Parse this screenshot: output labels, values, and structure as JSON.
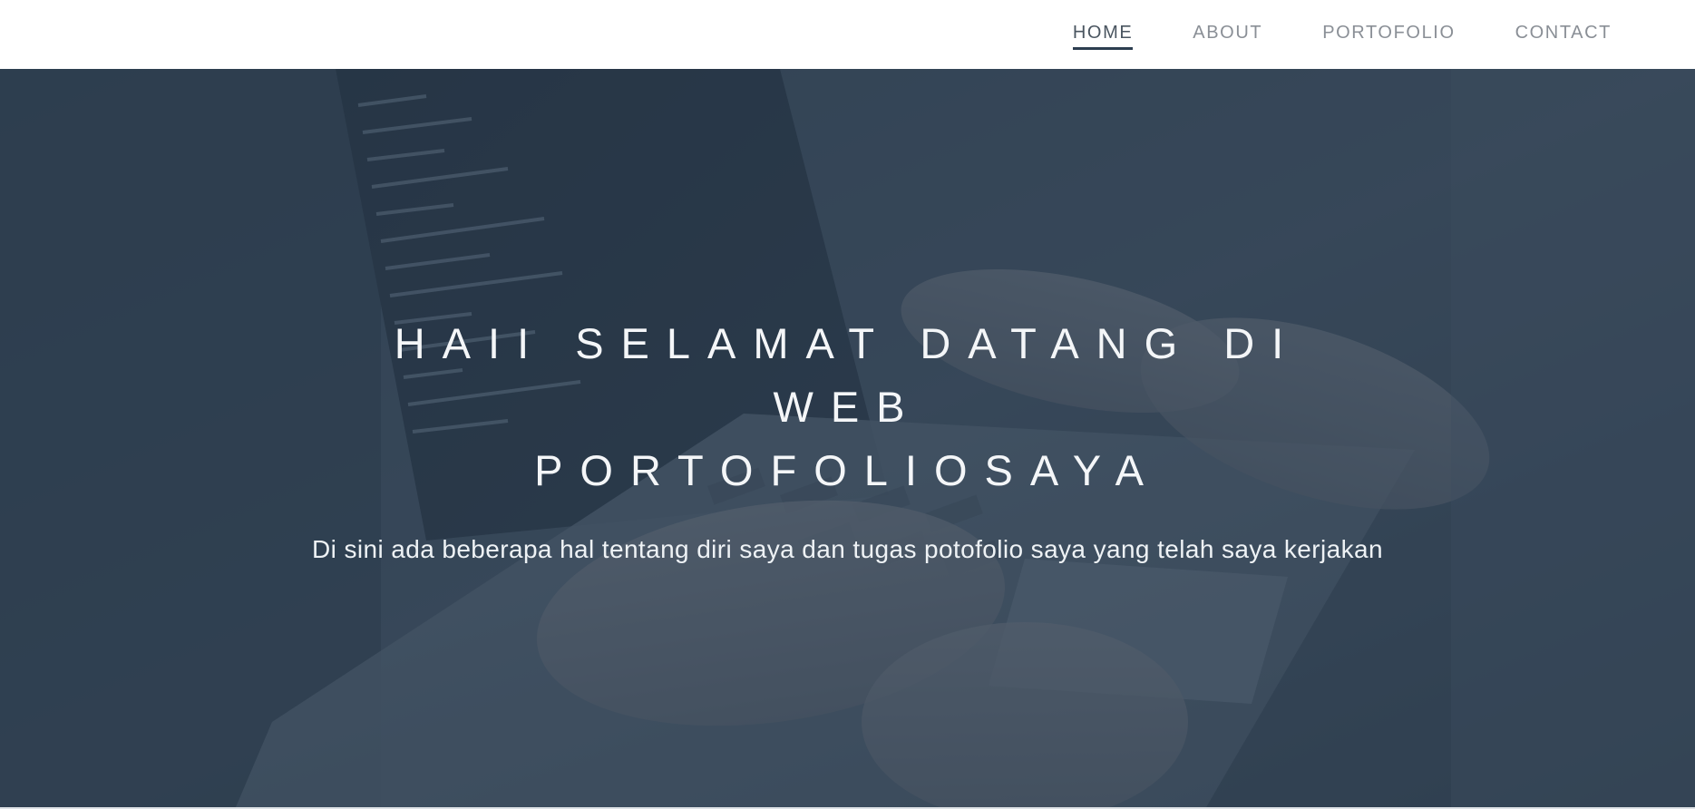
{
  "nav": {
    "items": [
      {
        "label": "HOME",
        "active": true
      },
      {
        "label": "ABOUT",
        "active": false
      },
      {
        "label": "PORTOFOLIO",
        "active": false
      },
      {
        "label": "CONTACT",
        "active": false
      }
    ]
  },
  "hero": {
    "title_line_1": "HAII SELAMAT DATANG DI WEB",
    "title_line_2": "PORTOFOLIOSAYA",
    "subtitle": "Di sini ada beberapa hal tentang diri saya dan tugas potofolio saya yang telah saya kerjakan",
    "background_image": "laptop-coding-hands"
  },
  "colors": {
    "nav_bg": "#ffffff",
    "nav_text": "#8a8f96",
    "nav_active_underline": "#2c3e50",
    "hero_overlay": "#2c3e50",
    "hero_text": "#ffffff"
  }
}
